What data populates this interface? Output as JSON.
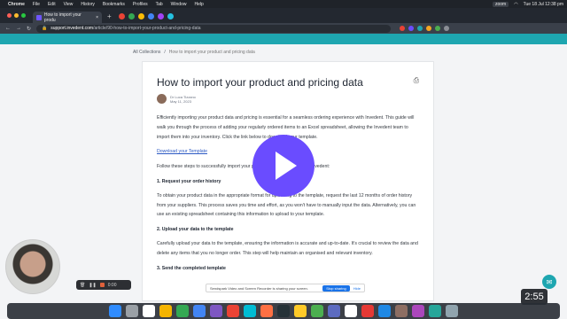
{
  "menubar": {
    "app": "Chrome",
    "items": [
      "File",
      "Edit",
      "View",
      "History",
      "Bookmarks",
      "Profiles",
      "Tab",
      "Window",
      "Help"
    ],
    "zoom": "zoom",
    "datetime": "Tue 18 Jul 12:38 pm"
  },
  "browser": {
    "tab_title": "How to import your produ",
    "tab_close": "×",
    "new_tab": "+",
    "url_domain": "support.invedent.com",
    "url_path": "/article/90-how-to-import-your-product-and-pricing-data"
  },
  "breadcrumb": {
    "root": "All Collections",
    "sep": "/",
    "current": "How to import your product and pricing data"
  },
  "article": {
    "title": "How to import your product and pricing data",
    "print_icon": "⎙",
    "author": "Dr Luca Tizzano",
    "date": "May 11, 2023",
    "intro": "Efficiently importing your product data and pricing is essential for a seamless ordering experience with Invedent. This guide will walk you through the process of adding your regularly ordered items to an Excel spreadsheet, allowing the Invedent team to import them into your inventory. Click the link below to download your template.",
    "template_link": "Download your Template",
    "steps_intro": "Follow these steps to successfully import your product data and pricing into Invedent:",
    "step1_heading": "1. Request your order history",
    "step1_text": "To obtain your product data in the appropriate format for uploading to the template, request the last 12 months of order history from your suppliers. This process saves you time and effort, as you won't have to manually input the data. Alternatively, you can use an existing spreadsheet containing this information to upload to your template.",
    "step2_heading": "2. Upload your data to the template",
    "step2_text": "Carefully upload your data to the template, ensuring the information is accurate and up-to-date. It's crucial to review the data and delete any items that you no longer order. This step will help maintain an organised and relevant inventory.",
    "step3_heading": "3. Send the completed template"
  },
  "recorder": {
    "time": "0:00",
    "share_text": "Sendspark Video and Screen Recorder is sharing your screen.",
    "stop_label": "Stop sharing",
    "hide_label": "Hide",
    "elapsed": "2:55"
  },
  "colors": {
    "brand": "#1ea6b0",
    "play": "#6a4cff"
  }
}
